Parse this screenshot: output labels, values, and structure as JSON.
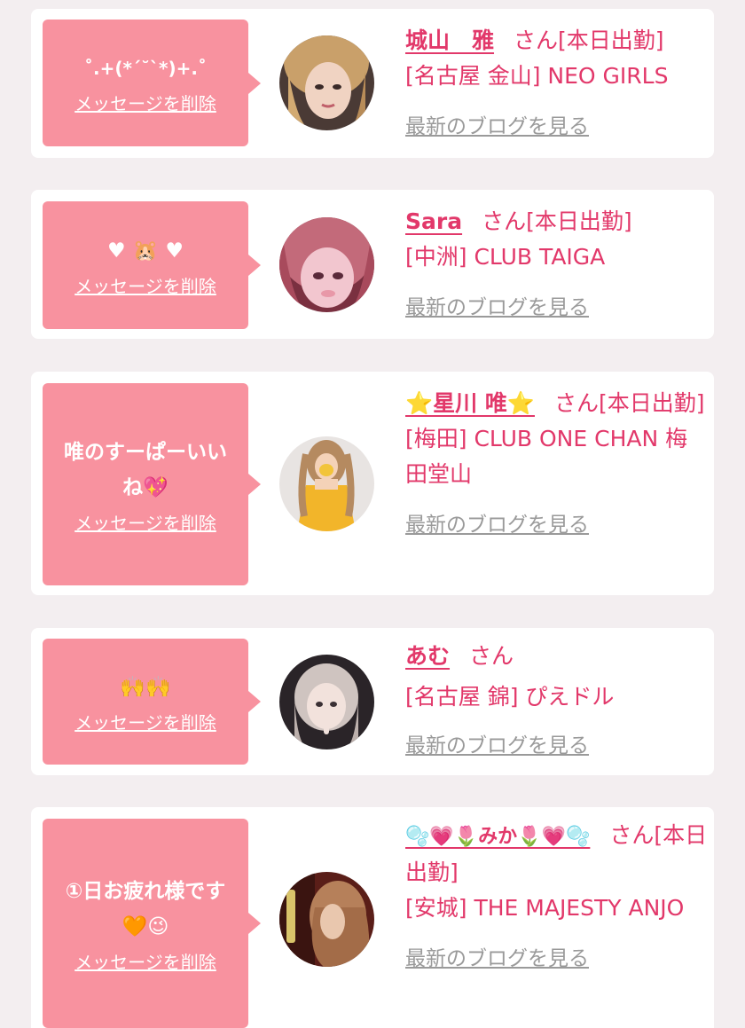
{
  "delete_label": "メッセージを削除",
  "blog_label": "最新のブログを見る",
  "honorific": "さん",
  "colors": {
    "background": "#f3eef0",
    "card": "#ffffff",
    "bubble": "#f8929f",
    "name_text": "#e2386a",
    "blog_link": "#9a9a9a"
  },
  "messages": [
    {
      "message": "˚.+(*´˘`*)+.˚",
      "name": "城山　雅",
      "status": "[本日出勤]",
      "shop": "[名古屋 金山] NEO GIRLS"
    },
    {
      "message": "♥ 🐹 ♥",
      "name": "Sara",
      "status": "[本日出勤]",
      "shop": "[中洲] CLUB TAIGA"
    },
    {
      "message": "唯のすーぱーいいね💖",
      "name": "⭐星川 唯⭐",
      "status": "[本日出勤]",
      "shop": "[梅田] CLUB ONE CHAN 梅田堂山"
    },
    {
      "message": "🙌🙌",
      "name": "あむ",
      "status": "",
      "shop": "[名古屋 錦] ぴえドル"
    },
    {
      "message": "①日お疲れ様です🧡😉",
      "name": "🫧💗🌷みか🌷💗🫧",
      "status": "[本日出勤]",
      "shop": "[安城] THE MAJESTY ANJO"
    }
  ]
}
